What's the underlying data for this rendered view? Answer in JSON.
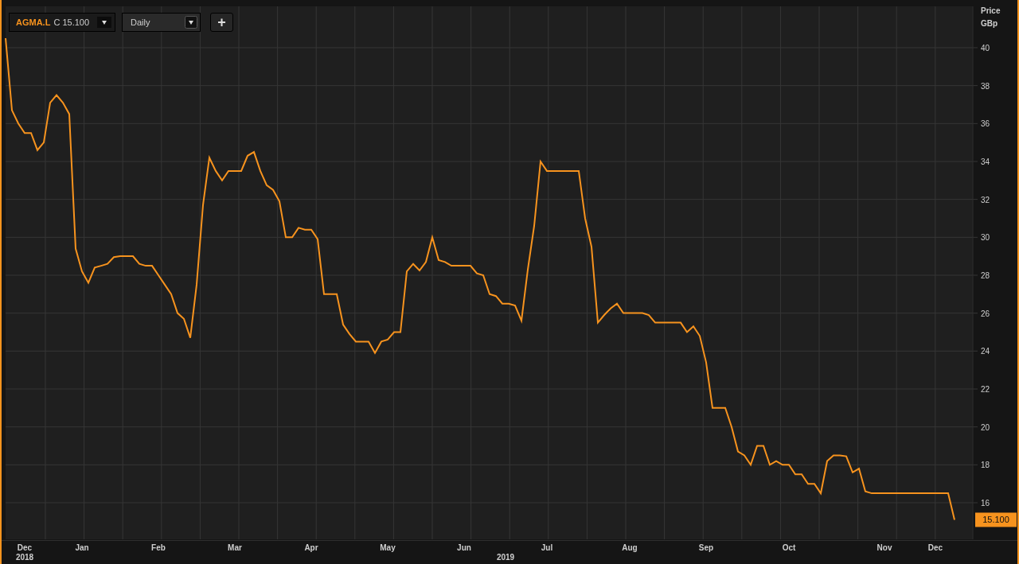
{
  "toolbar": {
    "quote": "C 15.100",
    "interval": "Daily",
    "add_label": "+"
  },
  "price_axis": {
    "title": "Price",
    "unit": "GBp"
  },
  "last_value": "15.100",
  "year_labels": [
    "2018",
    "2019"
  ],
  "chart_data": {
    "type": "line",
    "grid": true,
    "ylim": [
      14.07,
      42.18
    ],
    "yticks": [
      16,
      18,
      20,
      22,
      24,
      26,
      28,
      30,
      32,
      34,
      36,
      38,
      40
    ],
    "categories": [
      null,
      null,
      null,
      "Dec",
      null,
      null,
      null,
      null,
      null,
      null,
      null,
      null,
      "Jan",
      null,
      null,
      null,
      null,
      null,
      null,
      null,
      null,
      null,
      null,
      null,
      "Feb",
      null,
      null,
      null,
      null,
      null,
      null,
      null,
      null,
      null,
      null,
      null,
      "Mar",
      null,
      null,
      null,
      null,
      null,
      null,
      null,
      null,
      null,
      null,
      null,
      "Apr",
      null,
      null,
      null,
      null,
      null,
      null,
      null,
      null,
      null,
      null,
      null,
      "May",
      null,
      null,
      null,
      null,
      null,
      null,
      null,
      null,
      null,
      null,
      null,
      "Jun",
      null,
      null,
      null,
      null,
      null,
      null,
      null,
      null,
      null,
      null,
      null,
      null,
      "Jul",
      null,
      null,
      null,
      null,
      null,
      null,
      null,
      null,
      null,
      null,
      null,
      null,
      "Aug",
      null,
      null,
      null,
      null,
      null,
      null,
      null,
      null,
      null,
      null,
      null,
      "Sep",
      null,
      null,
      null,
      null,
      null,
      null,
      null,
      null,
      null,
      null,
      null,
      null,
      "Oct",
      null,
      null,
      null,
      null,
      null,
      null,
      null,
      null,
      null,
      null,
      null,
      null,
      null,
      null,
      "Nov",
      null,
      null,
      null,
      null,
      null,
      null,
      null,
      "Dec",
      null,
      null,
      null
    ],
    "series": [
      {
        "name": "AGMA.L",
        "color": "#f7931e",
        "values": [
          40.5,
          36.7,
          36,
          35.5,
          35.5,
          34.6,
          35,
          37.1,
          37.5,
          37.1,
          36.5,
          29.4,
          28.2,
          27.6,
          28.4,
          28.5,
          28.6,
          28.95,
          29,
          29,
          29,
          28.6,
          28.5,
          28.5,
          28,
          27.5,
          27,
          26,
          25.7,
          24.7,
          27.5,
          31.7,
          34.2,
          33.5,
          33,
          33.5,
          33.5,
          33.5,
          34.3,
          34.5,
          33.5,
          32.75,
          32.5,
          31.9,
          30,
          30,
          30.5,
          30.4,
          30.4,
          29.9,
          27,
          27,
          27,
          25.4,
          24.9,
          24.5,
          24.5,
          24.5,
          23.9,
          24.5,
          24.6,
          25,
          25,
          28.2,
          28.6,
          28.25,
          28.7,
          30,
          28.8,
          28.7,
          28.5,
          28.5,
          28.5,
          28.5,
          28.1,
          28,
          27,
          26.9,
          26.5,
          26.5,
          26.4,
          25.6,
          28.3,
          30.6,
          34,
          33.5,
          33.5,
          33.5,
          33.5,
          33.5,
          33.5,
          31,
          29.5,
          25.5,
          25.9,
          26.25,
          26.5,
          26,
          26,
          26,
          26,
          25.9,
          25.5,
          25.5,
          25.5,
          25.5,
          25.5,
          25,
          25.3,
          24.8,
          23.4,
          21,
          21,
          21,
          20,
          18.7,
          18.5,
          18,
          19,
          19,
          18,
          18.2,
          18,
          18,
          17.5,
          17.5,
          17,
          17,
          16.5,
          18.2,
          18.5,
          18.5,
          18.45,
          17.6,
          17.8,
          16.6,
          16.5,
          16.5,
          16.5,
          16.5,
          16.5,
          16.5,
          16.5,
          16.5,
          16.5,
          16.5,
          16.5,
          16.5,
          16.5,
          15.1
        ]
      }
    ]
  }
}
